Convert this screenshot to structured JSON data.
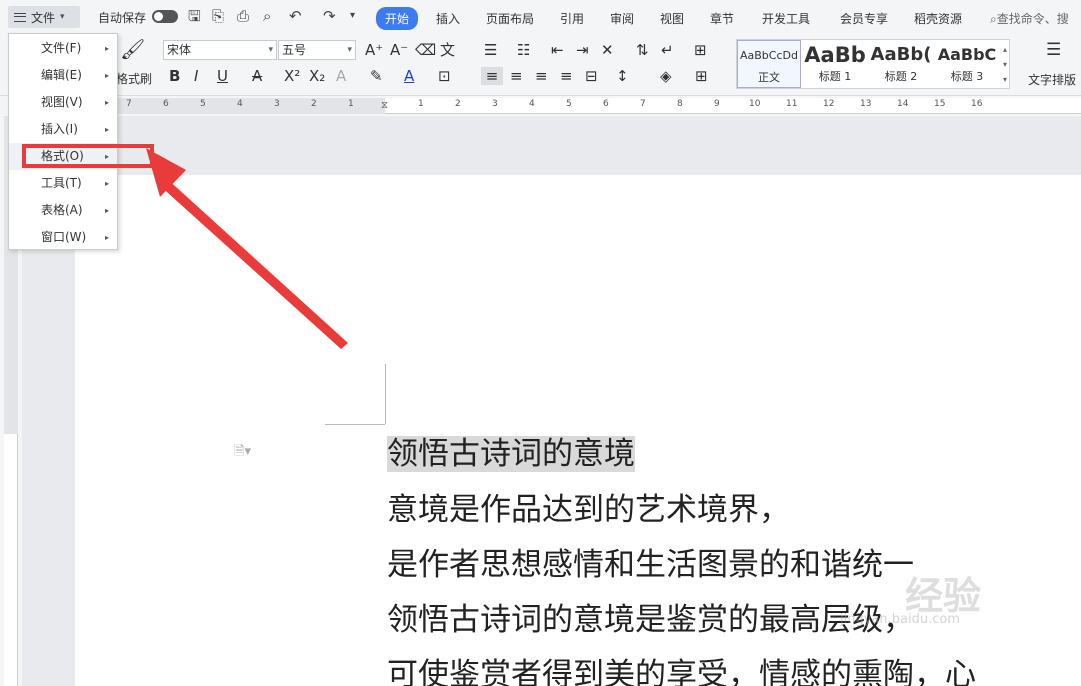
{
  "titlebar": {
    "file_label": "文件",
    "autosave_label": "自动保存",
    "tabs": [
      "开始",
      "插入",
      "页面布局",
      "引用",
      "审阅",
      "视图",
      "章节",
      "开发工具",
      "会员专享",
      "稻壳资源"
    ],
    "search_placeholder": "查找命令、搜"
  },
  "ribbon": {
    "format_painter_label": "格式刷",
    "font_name": "宋体",
    "font_size": "五号",
    "styles": [
      {
        "preview": "AaBbCcDd",
        "name": "正文"
      },
      {
        "preview": "AaBb",
        "name": "标题 1"
      },
      {
        "preview": "AaBb(",
        "name": "标题 2"
      },
      {
        "preview": "AaBbC",
        "name": "标题 3"
      }
    ],
    "text_layout_label": "文字排版"
  },
  "ruler_numbers": [
    "7",
    "6",
    "5",
    "4",
    "3",
    "2",
    "1",
    "1",
    "2",
    "3",
    "4",
    "5",
    "6",
    "7",
    "8",
    "9",
    "10",
    "11",
    "12",
    "13",
    "14",
    "15",
    "16"
  ],
  "menu": {
    "items": [
      {
        "label": "文件(F)"
      },
      {
        "label": "编辑(E)"
      },
      {
        "label": "视图(V)"
      },
      {
        "label": "插入(I)"
      },
      {
        "label": "格式(O)"
      },
      {
        "label": "工具(T)"
      },
      {
        "label": "表格(A)"
      },
      {
        "label": "窗口(W)"
      }
    ]
  },
  "document": {
    "lines": [
      "领悟古诗词的意境",
      "意境是作品达到的艺术境界，",
      "是作者思想感情和生活图景的和谐统一",
      "领悟古诗词的意境是鉴赏的最高层级，",
      "可使鉴赏者得到美的享受，情感的熏陶，心"
    ]
  },
  "watermark": {
    "text": "经验",
    "url_text": "jingyan.baidu.com"
  },
  "colors": {
    "accent": "#3c7cf0",
    "annotation": "#ea3b3b"
  }
}
